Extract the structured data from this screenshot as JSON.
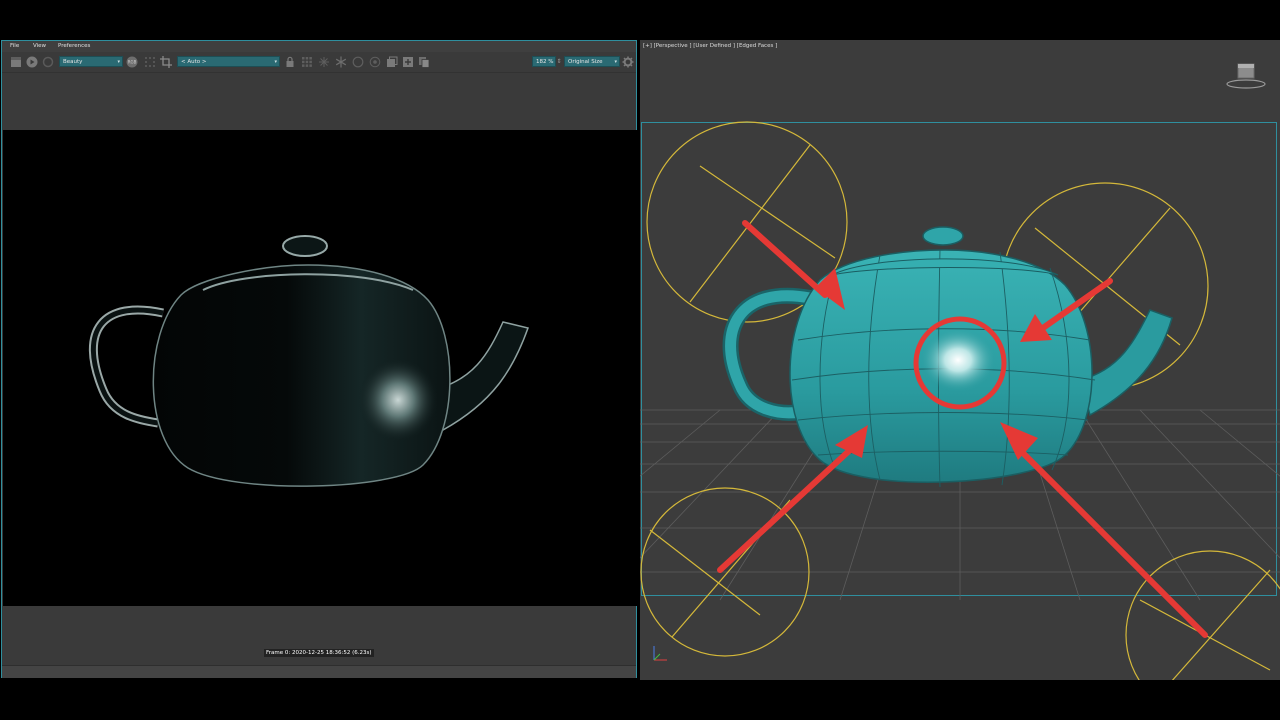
{
  "vfb": {
    "menu": [
      "File",
      "View",
      "Preferences"
    ],
    "channel_value": "Beauty",
    "lut_value": "< Auto >",
    "zoom_value": "182 %",
    "size_value": "Original Size",
    "status_text": "Frame 0: 2020-12-25 18:36:52 (6.23s)"
  },
  "viewport": {
    "label": "[+] [Perspective ] [User Defined ] [Edged Faces ]"
  },
  "colors": {
    "accent": "#2f8f9e",
    "panel": "#3a3a3a",
    "teapot": "#2a9b9f",
    "annotation": "#e53935",
    "light_gizmo": "#d4b83a"
  },
  "icons": [
    "clapperboard-icon",
    "play-icon",
    "refresh-icon",
    "rgb-icon",
    "crop-icon",
    "lock-icon",
    "grid-icon",
    "snowflake-icon",
    "circle-icon",
    "layers-icon",
    "copy-icon",
    "gear-icon",
    "viewcube-icon"
  ]
}
